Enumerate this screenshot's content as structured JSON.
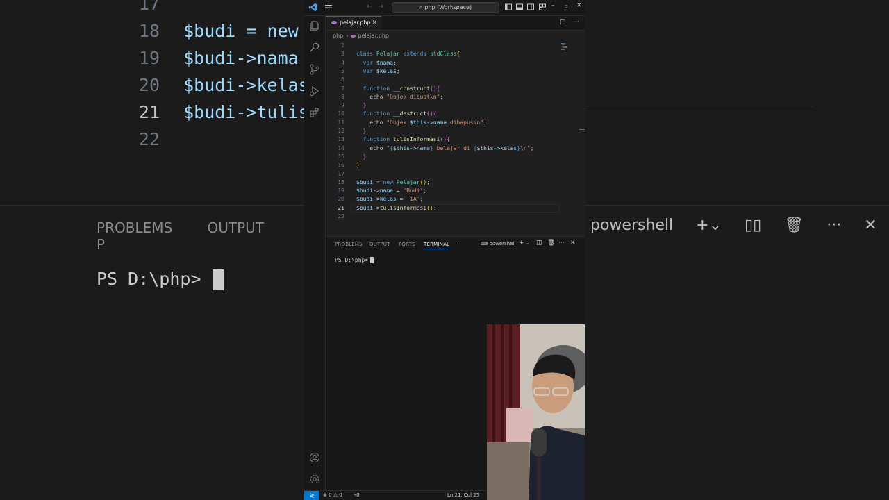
{
  "background_zoom": {
    "lines": [
      {
        "num": "17",
        "text": ""
      },
      {
        "num": "18",
        "text": "$budi = new P"
      },
      {
        "num": "19",
        "text": "$budi->nama ="
      },
      {
        "num": "20",
        "text": "$budi->kelas "
      },
      {
        "num": "21",
        "text": "$budi->tulisI"
      },
      {
        "num": "22",
        "text": ""
      }
    ],
    "panel_tabs": [
      "PROBLEMS",
      "OUTPUT",
      "P"
    ],
    "prompt": "PS D:\\php>",
    "shell_label": "powershell"
  },
  "titlebar": {
    "search": "php (Workspace)"
  },
  "tabs": [
    {
      "label": "pelajar.php",
      "active": true
    }
  ],
  "breadcrumb": [
    "php",
    "pelajar.php"
  ],
  "editor": {
    "active_line": 21,
    "lines": [
      {
        "n": "2",
        "parts": []
      },
      {
        "n": "3",
        "parts": [
          [
            "kw",
            "class "
          ],
          [
            "cls",
            "Pelajar "
          ],
          [
            "kw",
            "extends "
          ],
          [
            "cls",
            "stdClass"
          ],
          [
            "br0",
            "{"
          ]
        ]
      },
      {
        "n": "4",
        "parts": [
          [
            "pl",
            "  "
          ],
          [
            "kw",
            "var "
          ],
          [
            "var",
            "$nama"
          ],
          [
            "pl",
            ";"
          ]
        ]
      },
      {
        "n": "5",
        "parts": [
          [
            "pl",
            "  "
          ],
          [
            "kw",
            "var "
          ],
          [
            "var",
            "$kelas"
          ],
          [
            "pl",
            ";"
          ]
        ]
      },
      {
        "n": "6",
        "parts": []
      },
      {
        "n": "7",
        "parts": [
          [
            "pl",
            "  "
          ],
          [
            "kw",
            "function "
          ],
          [
            "fn",
            "__construct"
          ],
          [
            "br1",
            "(){"
          ]
        ]
      },
      {
        "n": "8",
        "parts": [
          [
            "pl",
            "    echo "
          ],
          [
            "str",
            "\"Objek dibuat\\n\""
          ],
          [
            "pl",
            ";"
          ]
        ]
      },
      {
        "n": "9",
        "parts": [
          [
            "pl",
            "  "
          ],
          [
            "br1",
            "}"
          ]
        ]
      },
      {
        "n": "10",
        "parts": [
          [
            "pl",
            "  "
          ],
          [
            "kw",
            "function "
          ],
          [
            "fn",
            "__destruct"
          ],
          [
            "br1",
            "(){"
          ]
        ]
      },
      {
        "n": "11",
        "parts": [
          [
            "pl",
            "    echo "
          ],
          [
            "str",
            "\"Objek "
          ],
          [
            "var",
            "$this->nama"
          ],
          [
            "str",
            " dihapus\\n\""
          ],
          [
            "pl",
            ";"
          ]
        ]
      },
      {
        "n": "12",
        "parts": [
          [
            "pl",
            "  "
          ],
          [
            "br1",
            "}"
          ]
        ]
      },
      {
        "n": "13",
        "parts": [
          [
            "pl",
            "  "
          ],
          [
            "kw",
            "function "
          ],
          [
            "fn",
            "tulisInformasi"
          ],
          [
            "br1",
            "(){"
          ]
        ]
      },
      {
        "n": "14",
        "parts": [
          [
            "pl",
            "    echo "
          ],
          [
            "str",
            "\""
          ],
          [
            "kw",
            "{"
          ],
          [
            "var",
            "$this->nama"
          ],
          [
            "kw",
            "}"
          ],
          [
            "str",
            " belajar di "
          ],
          [
            "kw",
            "{"
          ],
          [
            "var",
            "$this->kelas"
          ],
          [
            "kw",
            "}"
          ],
          [
            "str",
            "\\n\""
          ],
          [
            "pl",
            ";"
          ]
        ]
      },
      {
        "n": "15",
        "parts": [
          [
            "pl",
            "  "
          ],
          [
            "br1",
            "}"
          ]
        ]
      },
      {
        "n": "16",
        "parts": [
          [
            "br0",
            "}"
          ]
        ]
      },
      {
        "n": "17",
        "parts": []
      },
      {
        "n": "18",
        "parts": [
          [
            "var",
            "$budi"
          ],
          [
            "pl",
            " = "
          ],
          [
            "kw",
            "new "
          ],
          [
            "cls",
            "Pelajar"
          ],
          [
            "br0",
            "()"
          ],
          [
            "pl",
            ";"
          ]
        ]
      },
      {
        "n": "19",
        "parts": [
          [
            "var",
            "$budi"
          ],
          [
            "pl",
            "->"
          ],
          [
            "var",
            "nama"
          ],
          [
            "pl",
            " = "
          ],
          [
            "str",
            "'Budi'"
          ],
          [
            "pl",
            ";"
          ]
        ]
      },
      {
        "n": "20",
        "parts": [
          [
            "var",
            "$budi"
          ],
          [
            "pl",
            "->"
          ],
          [
            "var",
            "kelas"
          ],
          [
            "pl",
            " = "
          ],
          [
            "str",
            "'1A'"
          ],
          [
            "pl",
            ";"
          ]
        ]
      },
      {
        "n": "21",
        "parts": [
          [
            "var",
            "$budi"
          ],
          [
            "pl",
            "->"
          ],
          [
            "fn",
            "tulisInformasi"
          ],
          [
            "br0",
            "()"
          ],
          [
            "pl",
            ";"
          ]
        ]
      },
      {
        "n": "22",
        "parts": []
      }
    ]
  },
  "panel": {
    "tabs": [
      "PROBLEMS",
      "OUTPUT",
      "PORTS",
      "TERMINAL"
    ],
    "active_tab": "TERMINAL",
    "more": "···",
    "shell": "powershell",
    "prompt": "PS D:\\php>"
  },
  "statusbar": {
    "problems": "⊗ 0 ⚠ 0",
    "ports": "0",
    "position": "Ln 21, Col 25"
  },
  "colors": {
    "accent": "#0078d4"
  }
}
